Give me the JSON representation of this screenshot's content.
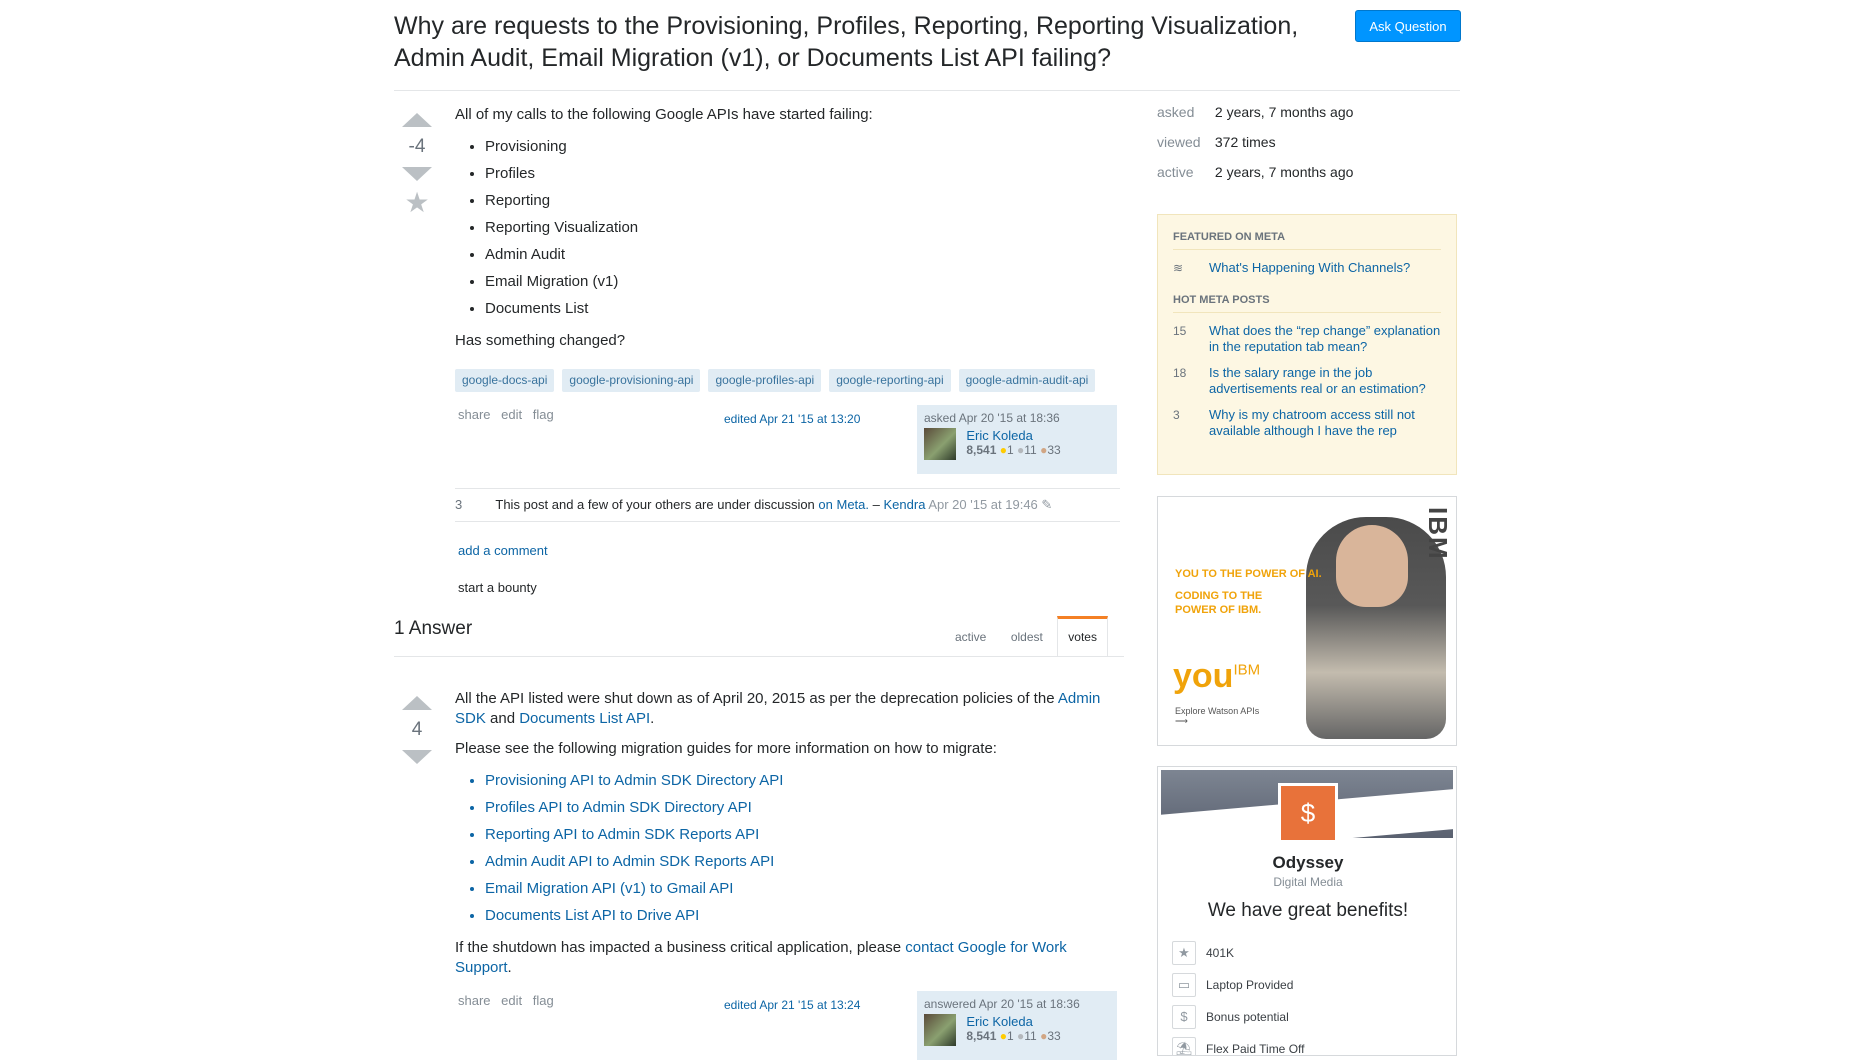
{
  "question": {
    "title": "Why are requests to the Provisioning, Profiles, Reporting, Reporting Visualization, Admin Audit, Email Migration (v1), or Documents List API failing?",
    "ask_button": "Ask Question",
    "votes": "-4",
    "intro": "All of my calls to the following Google APIs have started failing:",
    "apis": [
      "Provisioning",
      "Profiles",
      "Reporting",
      "Reporting Visualization",
      "Admin Audit",
      "Email Migration (v1)",
      "Documents List"
    ],
    "closing": "Has something changed?",
    "tags": [
      "google-docs-api",
      "google-provisioning-api",
      "google-profiles-api",
      "google-reporting-api",
      "google-admin-audit-api"
    ],
    "menu": {
      "share": "share",
      "edit": "edit",
      "flag": "flag"
    },
    "edited": "edited Apr 21 '15 at 13:20",
    "signature": {
      "action": "asked Apr 20 '15 at 18:36",
      "user": "Eric Koleda",
      "rep": "8,541",
      "gold": "1",
      "silver": "11",
      "bronze": "33"
    },
    "comment": {
      "score": "3",
      "text": "This post and a few of your others are under discussion",
      "link": "on Meta.",
      "dash": "–",
      "user": "Kendra",
      "date": "Apr 20 '15 at 19:46",
      "edit_icon": "pencil-icon"
    },
    "add_comment": "add a comment",
    "bounty": "start a bounty"
  },
  "answers_header": {
    "count": "1 Answer",
    "tabs": [
      "active",
      "oldest",
      "votes"
    ],
    "active_tab": "votes"
  },
  "answer": {
    "votes": "4",
    "p1_start": "All the API listed were shut down as of April 20, 2015 as per the deprecation policies of the",
    "p1_link1": "Admin SDK",
    "p1_and": "and",
    "p1_link2": "Documents List API",
    "p1_end": ".",
    "p2": "Please see the following migration guides for more information on how to migrate:",
    "guides": [
      "Provisioning API to Admin SDK Directory API",
      "Profiles API to Admin SDK Directory API",
      "Reporting API to Admin SDK Reports API",
      "Admin Audit API to Admin SDK Reports API",
      "Email Migration API (v1) to Gmail API",
      "Documents List API to Drive API"
    ],
    "p3_start": "If the shutdown has impacted a business critical application, please",
    "p3_link": "contact Google for Work Support",
    "p3_end": ".",
    "menu": {
      "share": "share",
      "edit": "edit",
      "flag": "flag"
    },
    "edited": "edited Apr 21 '15 at 13:24",
    "signature": {
      "action": "answered Apr 20 '15 at 18:36",
      "user": "Eric Koleda",
      "rep": "8,541",
      "gold": "1",
      "silver": "11",
      "bronze": "33"
    }
  },
  "sidebar": {
    "stats": [
      {
        "label": "asked",
        "value": "2 years, 7 months ago"
      },
      {
        "label": "viewed",
        "value": "372 times"
      },
      {
        "label": "active",
        "value": "2 years, 7 months ago"
      }
    ],
    "featured_heading": "FEATURED ON META",
    "featured_item": "What's Happening With Channels?",
    "hot_heading": "HOT META POSTS",
    "hot_posts": [
      {
        "score": "15",
        "title": "What does the “rep change” explanation in the reputation tab mean?"
      },
      {
        "score": "18",
        "title": "Is the salary range in the job advertisements real or an estimation?"
      },
      {
        "score": "3",
        "title": "Why is my chatroom access still not available although I have the rep"
      }
    ]
  },
  "ibm_ad": {
    "logo": "IBM",
    "line1": "YOU TO THE POWER OF AI.",
    "line2": "CODING TO THE",
    "line3": "POWER OF IBM.",
    "you": "you",
    "you_sup": "IBM",
    "explore": "Explore Watson APIs"
  },
  "odyssey_ad": {
    "name": "Odyssey",
    "subtitle": "Digital Media",
    "benefits_heading": "We have great benefits!",
    "benefits": [
      {
        "icon": "star-icon",
        "label": "401K"
      },
      {
        "icon": "monitor-icon",
        "label": "Laptop Provided"
      },
      {
        "icon": "dollar-icon",
        "label": "Bonus potential"
      },
      {
        "icon": "palm-tree-icon",
        "label": "Flex Paid Time Off"
      }
    ]
  },
  "colors": {
    "accent": "#0095ff",
    "link": "#0C65A5",
    "tag_bg": "#e1ecf4",
    "tag_text": "#39739d",
    "meta_box": "#fdf7e3",
    "orange": "#f48024"
  }
}
